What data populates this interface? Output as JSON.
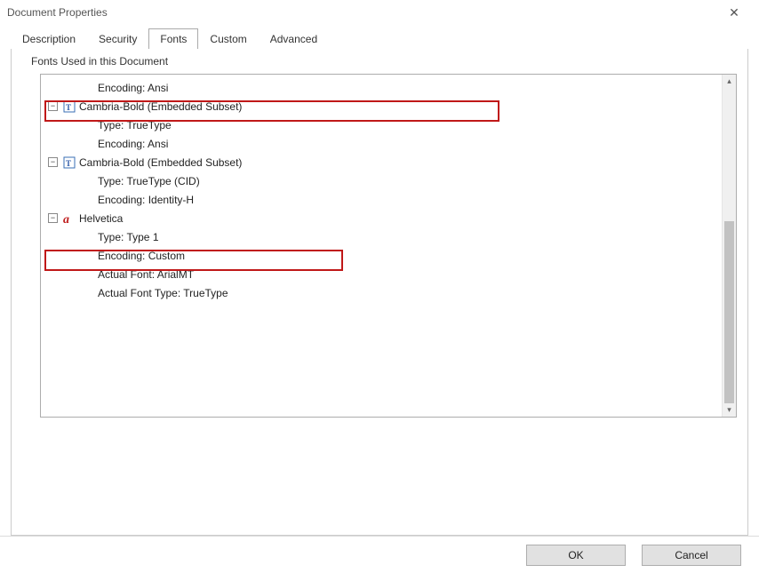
{
  "window": {
    "title": "Document Properties"
  },
  "tabs": {
    "description": "Description",
    "security": "Security",
    "fonts": "Fonts",
    "custom": "Custom",
    "advanced": "Advanced"
  },
  "panel": {
    "legend": "Fonts Used in this Document"
  },
  "tree": {
    "row_encoding_ansi_top": "Encoding: Ansi",
    "cambria1": {
      "label": "Cambria-Bold (Embedded Subset)",
      "type": "Type: TrueType",
      "encoding": "Encoding: Ansi"
    },
    "cambria2": {
      "label": "Cambria-Bold (Embedded Subset)",
      "type": "Type: TrueType (CID)",
      "encoding": "Encoding: Identity-H"
    },
    "helvetica": {
      "label": "Helvetica",
      "type": "Type: Type 1",
      "encoding": "Encoding: Custom",
      "actual_font": "Actual Font: ArialMT",
      "actual_type": "Actual Font Type: TrueType"
    }
  },
  "footer": {
    "ok": "OK",
    "cancel": "Cancel"
  }
}
